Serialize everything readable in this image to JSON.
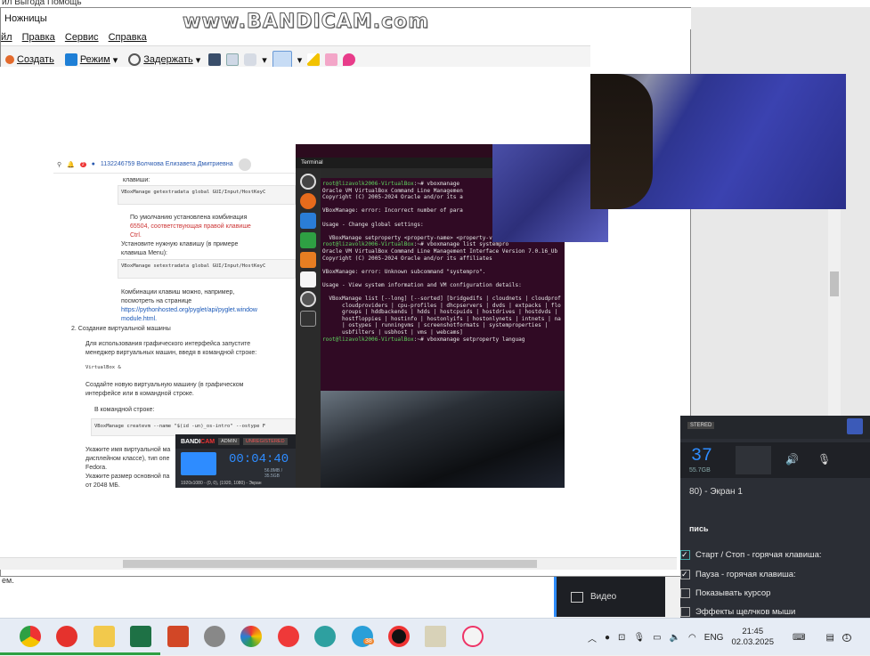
{
  "top_strip": {
    "text": "йл   Выгода    Помощь"
  },
  "snipping_tool": {
    "title": "Ножницы",
    "menu": [
      "йл",
      "Правка",
      "Сервис",
      "Справка"
    ],
    "toolbar": {
      "create": "Создать",
      "mode": "Режим",
      "delay": "Задержать"
    }
  },
  "watermark": "www.BANDICAM.com",
  "document": {
    "user": "1132246759 Волчкова Елизавета Дмитриевна",
    "notification_count": "2",
    "lines": [
      "клавиши:",
      "VBoxManage getextradata global GUI/Input/HostKeyC",
      "По умолчанию установлена комбинация",
      "65504, соответствующая правой клавише",
      "Ctrl.",
      "Установите нужную клавишу (в примере",
      "клавиша Menu):",
      "VBoxManage setextradata global GUI/Input/HostKeyC",
      "Комбинации клавиш можно, например,",
      "посмотреть на странице",
      "https://pythonhosted.org/pyglet/api/pyglet.window",
      "module.html.",
      "2. Создание виртуальной машины",
      "Для использования графического интерфейса запустите",
      "менеджер виртуальных машин, введя в командной строке:",
      "VirtualBox &",
      "Создайте новую виртуальную машину (в графическом",
      "интерфейсе или в командной строке.",
      "В командной строке:",
      "VBoxManage createvm --name \"$(id -un)_os-intro\" --ostype F",
      "Укажите имя виртуальной ма",
      "дисплейном классе), тип опе",
      "Fedora.",
      "Укажите размер основной па",
      "от 2048 МБ."
    ]
  },
  "terminal": {
    "label": "Terminal",
    "window_title": "root@lizavolk2006-",
    "lines": [
      {
        "p": "root@lizavolk2006-VirtualBox",
        "t": ":~# vboxmanage"
      },
      {
        "p": "",
        "t": "Oracle VM VirtualBox Command Line Managemen"
      },
      {
        "p": "",
        "t": "Copyright (C) 2005-2024 Oracle and/or its a"
      },
      {
        "p": "",
        "t": ""
      },
      {
        "p": "",
        "t": "VBoxManage: error: Incorrect number of para"
      },
      {
        "p": "",
        "t": ""
      },
      {
        "p": "",
        "t": "Usage - Change global settings:"
      },
      {
        "p": "",
        "t": ""
      },
      {
        "p": "",
        "t": "  VBoxManage setproperty <property-name> <property-value>"
      },
      {
        "p": "root@lizavolk2006-VirtualBox",
        "t": ":~# vboxmanage list systempro"
      },
      {
        "p": "",
        "t": "Oracle VM VirtualBox Command Line Management Interface Version 7.0.16_Ub"
      },
      {
        "p": "",
        "t": "Copyright (C) 2005-2024 Oracle and/or its affiliates"
      },
      {
        "p": "",
        "t": ""
      },
      {
        "p": "",
        "t": "VBoxManage: error: Unknown subcommand \"systempro\"."
      },
      {
        "p": "",
        "t": ""
      },
      {
        "p": "",
        "t": "Usage - View system information and VM configuration details:"
      },
      {
        "p": "",
        "t": ""
      },
      {
        "p": "",
        "t": "  VBoxManage list [--long] [--sorted] [bridgedifs | cloudnets | cloudprof"
      },
      {
        "p": "",
        "t": "      cloudproviders | cpu-profiles | dhcpservers | dvds | extpacks | flo"
      },
      {
        "p": "",
        "t": "      groups | hddbackends | hdds | hostcpuids | hostdrives | hostdvds |"
      },
      {
        "p": "",
        "t": "      hostfloppies | hostinfo | hostonlyifs | hostonlynets | intnets | na"
      },
      {
        "p": "",
        "t": "      | ostypes | runningvms | screenshotformats | systemproperties |"
      },
      {
        "p": "",
        "t": "      usbfilters | usbhost | vms | webcams]"
      },
      {
        "p": "root@lizavolk2006-VirtualBox",
        "t": ":~# vboxmanage setproperty languag"
      }
    ]
  },
  "mini_bandicam": {
    "logo_a": "BANDI",
    "logo_b": "CAM",
    "tab1": "ADMIN",
    "tab2": "UNREGISTERED",
    "time": "00:04:40",
    "size": "56.8MB / 35.5GB",
    "resolution": "1920x1080 - (0, 0), (1920, 1080) - Экран"
  },
  "bandicam_panel": {
    "badge": "STERED",
    "time": "37",
    "size": "55.7GB",
    "screen": "80) - Экран 1",
    "section": "пись",
    "options": [
      {
        "label": "Старт / Стоп - горячая клавиша:",
        "checked": true
      },
      {
        "label": "Пауза - горячая клавиша:",
        "checked": true
      },
      {
        "label": "Показывать курсор",
        "checked": false
      },
      {
        "label": "Эффекты щелчков мыши",
        "checked": false
      }
    ],
    "video_tab": "Видео"
  },
  "below_text": "ем.",
  "tray": {
    "lang": "ENG",
    "time": "21:45",
    "date": "02.03.2025",
    "badge": "38",
    "notif": "1"
  }
}
